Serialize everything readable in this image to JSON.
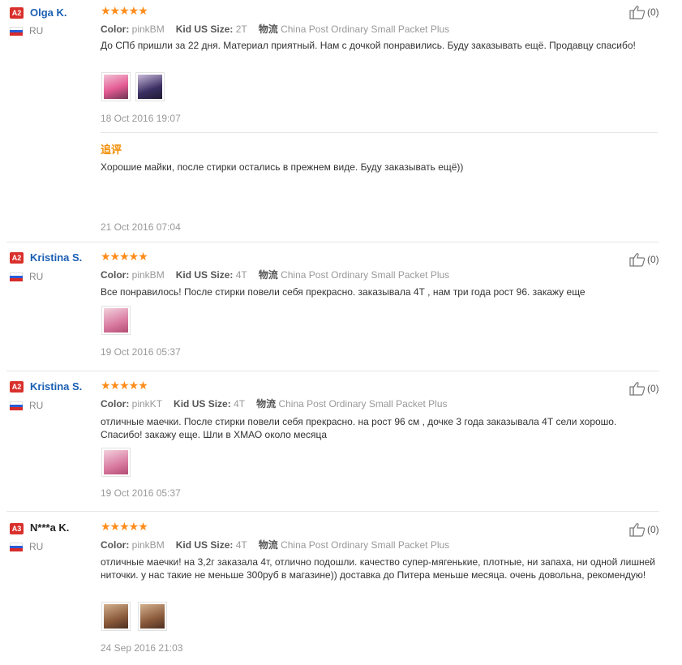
{
  "labels": {
    "color": "Color:",
    "size": "Kid US Size:",
    "shipping": "物流",
    "followup": "追评"
  },
  "reviews": [
    {
      "level": "A2",
      "name": "Olga K.",
      "country": "RU",
      "stars": "★★★★★",
      "color": "pinkBM",
      "size": "2T",
      "shipping": "China Post Ordinary Small Packet Plus",
      "text": "До СПб пришли за 22 дня. Материал приятный. Нам с дочкой понравились. Буду заказывать ещё. Продавцу спасибо!",
      "date": "18 Oct 2016 19:07",
      "followup_text": "Хорошие майки, после стирки остались в прежнем виде. Буду заказывать ещё))",
      "followup_date": "21 Oct 2016 07:04",
      "likes": "(0)"
    },
    {
      "level": "A2",
      "name": "Kristina S.",
      "country": "RU",
      "stars": "★★★★★",
      "color": "pinkBM",
      "size": "4T",
      "shipping": "China Post Ordinary Small Packet Plus",
      "text": "Все понравилось! После стирки повели себя прекрасно. заказывала 4Т , нам три года рост 96. закажу еще",
      "date": "19 Oct 2016 05:37",
      "likes": "(0)"
    },
    {
      "level": "A2",
      "name": "Kristina S.",
      "country": "RU",
      "stars": "★★★★★",
      "color": "pinkKT",
      "size": "4T",
      "shipping": "China Post Ordinary Small Packet Plus",
      "text": "отличные маечки. После стирки повели себя прекрасно. на рост 96 см , дочке 3 года заказывала 4Т сели хорошо. Спасибо! закажу еще. Шли в ХМАО около месяца",
      "date": "19 Oct 2016 05:37",
      "likes": "(0)"
    },
    {
      "level": "A3",
      "name": "N***a K.",
      "country": "RU",
      "stars": "★★★★★",
      "color": "pinkBM",
      "size": "4T",
      "shipping": "China Post Ordinary Small Packet Plus",
      "text": "отличные маечки! на 3,2г заказала 4т, отлично подошли. качество супер-мягенькие, плотные, ни запаха, ни одной лишней ниточки. у нас такие не меньше 300руб в магазине)) доставка до Питера меньше месяца. очень довольна, рекомендую!",
      "date": "24 Sep 2016 21:03",
      "likes": "(0)"
    }
  ]
}
